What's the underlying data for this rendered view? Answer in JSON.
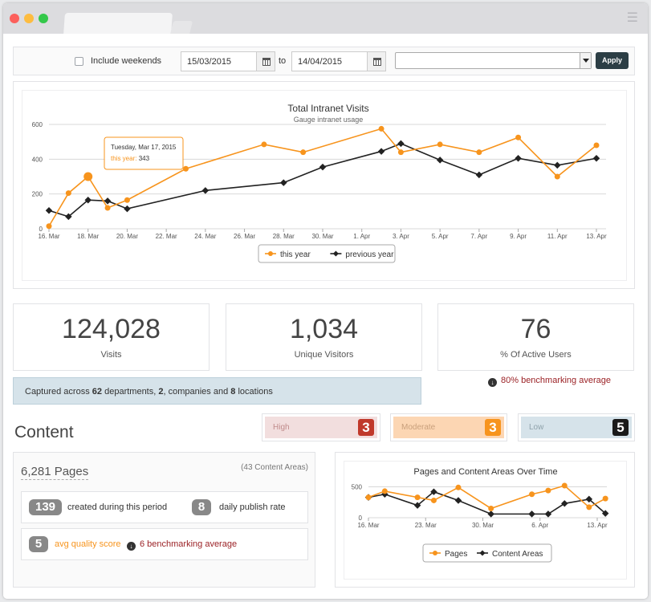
{
  "filters": {
    "include_weekends_label": "Include weekends",
    "date_from": "15/03/2015",
    "to_label": "to",
    "date_to": "14/04/2015",
    "select_value": "",
    "apply_label": "Apply"
  },
  "colors": {
    "this_year": "#f7941d",
    "previous_year": "#222222",
    "high": "#c0392b",
    "moderate": "#f7941d",
    "low": "#1a1a1a",
    "bench": "#9b2226"
  },
  "chart_data": [
    {
      "type": "line",
      "title": "Total Intranet Visits",
      "subtitle": "Gauge intranet usage",
      "x_ticks": [
        "16. Mar",
        "18. Mar",
        "20. Mar",
        "22. Mar",
        "24. Mar",
        "26. Mar",
        "28. Mar",
        "30. Mar",
        "1. Apr",
        "3. Apr",
        "5. Apr",
        "7. Apr",
        "9. Apr",
        "11. Apr",
        "13. Apr"
      ],
      "xlim": [
        "2015-03-16",
        "2015-04-13"
      ],
      "y_ticks": [
        0,
        200,
        400,
        600
      ],
      "ylim": [
        0,
        600
      ],
      "grid": true,
      "legend": "bottom",
      "series": [
        {
          "name": "this year",
          "points": [
            [
              "2015-03-16",
              15
            ],
            [
              "2015-03-17",
              205
            ],
            [
              "2015-03-18",
              300
            ],
            [
              "2015-03-19",
              120
            ],
            [
              "2015-03-20",
              165
            ],
            [
              "2015-03-23",
              345
            ],
            [
              "2015-03-27",
              485
            ],
            [
              "2015-03-29",
              440
            ],
            [
              "2015-04-02",
              575
            ],
            [
              "2015-04-03",
              440
            ],
            [
              "2015-04-05",
              485
            ],
            [
              "2015-04-07",
              440
            ],
            [
              "2015-04-09",
              525
            ],
            [
              "2015-04-11",
              300
            ],
            [
              "2015-04-13",
              480
            ]
          ]
        },
        {
          "name": "previous year",
          "points": [
            [
              "2015-03-16",
              105
            ],
            [
              "2015-03-17",
              70
            ],
            [
              "2015-03-18",
              165
            ],
            [
              "2015-03-19",
              160
            ],
            [
              "2015-03-20",
              115
            ],
            [
              "2015-03-24",
              220
            ],
            [
              "2015-03-28",
              265
            ],
            [
              "2015-03-30",
              355
            ],
            [
              "2015-04-02",
              445
            ],
            [
              "2015-04-03",
              490
            ],
            [
              "2015-04-05",
              395
            ],
            [
              "2015-04-07",
              310
            ],
            [
              "2015-04-09",
              405
            ],
            [
              "2015-04-11",
              365
            ],
            [
              "2015-04-13",
              405
            ]
          ]
        }
      ],
      "tooltip": {
        "date": "Tuesday, Mar 17, 2015",
        "series": "this year",
        "value": "343"
      }
    },
    {
      "type": "line",
      "title": "Pages and Content Areas Over Time",
      "x_ticks": [
        "16. Mar",
        "23. Mar",
        "30. Mar",
        "6. Apr",
        "13. Apr"
      ],
      "xlim": [
        "2015-03-16",
        "2015-04-13"
      ],
      "y_ticks": [
        0,
        500
      ],
      "ylim": [
        0,
        650
      ],
      "grid": true,
      "legend": "bottom",
      "series": [
        {
          "name": "Pages",
          "points": [
            [
              "2015-03-16",
              330
            ],
            [
              "2015-03-18",
              430
            ],
            [
              "2015-03-22",
              330
            ],
            [
              "2015-03-24",
              280
            ],
            [
              "2015-03-27",
              490
            ],
            [
              "2015-03-31",
              150
            ],
            [
              "2015-04-05",
              380
            ],
            [
              "2015-04-07",
              440
            ],
            [
              "2015-04-09",
              520
            ],
            [
              "2015-04-12",
              170
            ],
            [
              "2015-04-14",
              310
            ]
          ]
        },
        {
          "name": "Content Areas",
          "points": [
            [
              "2015-03-16",
              330
            ],
            [
              "2015-03-18",
              380
            ],
            [
              "2015-03-22",
              200
            ],
            [
              "2015-03-24",
              420
            ],
            [
              "2015-03-27",
              280
            ],
            [
              "2015-03-31",
              60
            ],
            [
              "2015-04-05",
              60
            ],
            [
              "2015-04-07",
              60
            ],
            [
              "2015-04-09",
              230
            ],
            [
              "2015-04-12",
              300
            ],
            [
              "2015-04-14",
              70
            ]
          ]
        }
      ]
    }
  ],
  "stats": [
    {
      "value": "124,028",
      "label": "Visits"
    },
    {
      "value": "1,034",
      "label": "Unique Visitors"
    },
    {
      "value": "76",
      "label": "% Of Active Users"
    }
  ],
  "benchmark_top": "80% benchmarking average",
  "captured": {
    "prefix": "Captured across",
    "departments": "62",
    "departments_label": "departments,",
    "companies": "2",
    "companies_label": ", companies",
    "and1": "and",
    "locations": "8",
    "locations_label": "locations"
  },
  "content": {
    "title": "Content",
    "levels": [
      {
        "label": "High",
        "count": "3"
      },
      {
        "label": "Moderate",
        "count": "3"
      },
      {
        "label": "Low",
        "count": "5"
      }
    ],
    "pages_title": "6,281 Pages",
    "areas_note": "(43 Content Areas)",
    "created_count": "139",
    "created_label": "created during this period",
    "daily_count": "8",
    "daily_label": "daily publish rate",
    "quality_score": "5",
    "quality_label": "avg quality score",
    "quality_bench": "6 benchmarking average"
  }
}
